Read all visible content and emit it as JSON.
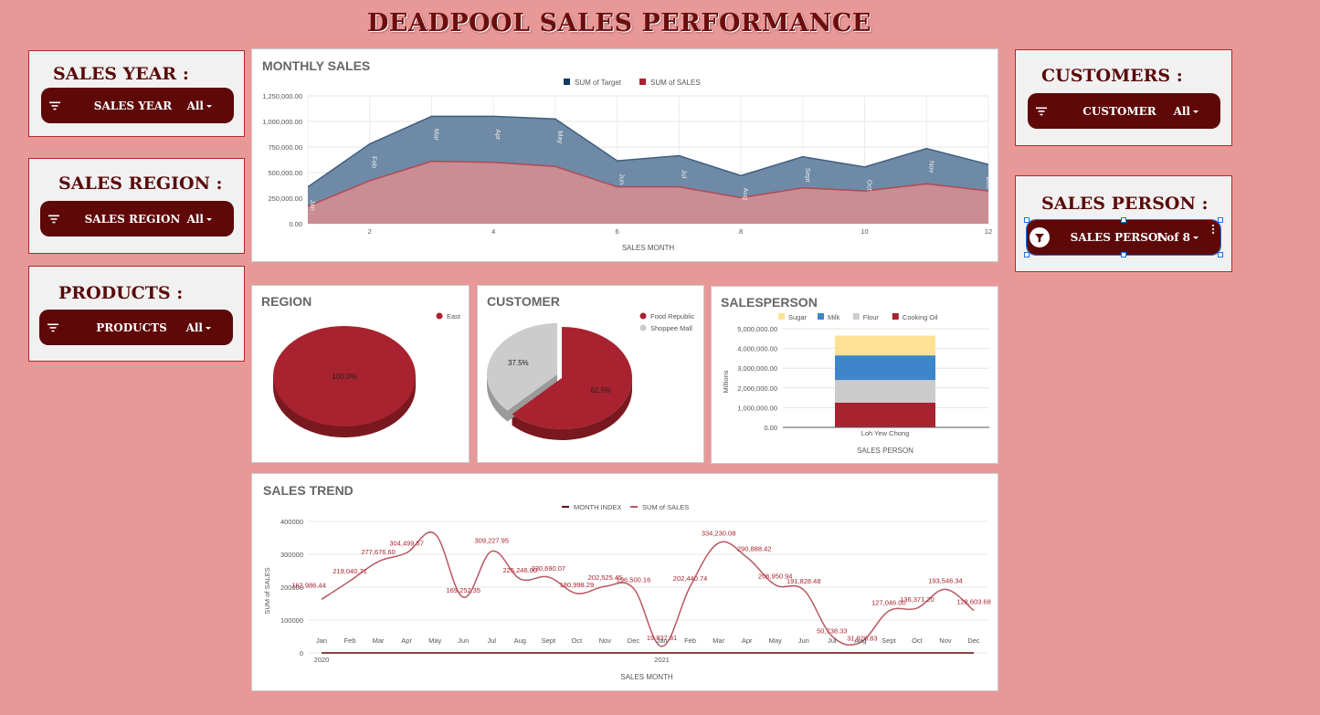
{
  "page_title": "DEADPOOL SALES PERFORMANCE",
  "colors": {
    "background": "#e99898",
    "pill": "#5e0808",
    "target": "#4a6f96",
    "sales": "#a8232f",
    "trend": "#b85860"
  },
  "controls": {
    "sales_year": {
      "label": "SALES YEAR :",
      "pill_label": "SALES YEAR",
      "value": "All"
    },
    "sales_region": {
      "label": "SALES REGION :",
      "pill_label": "SALES REGION",
      "value": "All"
    },
    "products": {
      "label": "PRODUCTS :",
      "pill_label": "PRODUCTS",
      "value": "All"
    },
    "customers": {
      "label": "CUSTOMERS :",
      "pill_label": "CUSTOMER",
      "value": "All"
    },
    "sales_person": {
      "label": "SALES PERSON :",
      "pill_label": "SALES PERSON",
      "value": "1 of 8"
    }
  },
  "chart_data": [
    {
      "id": "monthly",
      "type": "area",
      "title": "MONTHLY SALES",
      "xlabel": "SALES MONTH",
      "x": [
        1,
        2,
        3,
        4,
        5,
        6,
        7,
        8,
        9,
        10,
        11,
        12
      ],
      "xticks": [
        "2",
        "4",
        "6",
        "8",
        "10",
        "12"
      ],
      "month_labels": [
        "Jan",
        "Feb",
        "Mar",
        "Apr",
        "May",
        "Jun",
        "Jul",
        "Aug",
        "Sept",
        "Oct",
        "Nov",
        "Dec"
      ],
      "yticks": [
        "0.00",
        "250,000.00",
        "500,000.00",
        "750,000.00",
        "1,000,000.00",
        "1,250,000.00"
      ],
      "ylim": [
        0,
        1250000
      ],
      "legend_position": "top",
      "series": [
        {
          "name": "SUM of Target",
          "color": "#0f3a66",
          "values": [
            360000,
            780000,
            1050000,
            1050000,
            1025000,
            615000,
            665000,
            470000,
            655000,
            555000,
            735000,
            580000
          ]
        },
        {
          "name": "SUM of SALES",
          "color": "#a8232f",
          "values": [
            170000,
            420000,
            610000,
            600000,
            560000,
            360000,
            360000,
            255000,
            350000,
            320000,
            390000,
            320000
          ]
        }
      ]
    },
    {
      "id": "region",
      "type": "pie",
      "title": "REGION",
      "slices": [
        {
          "name": "East",
          "value": 100.0,
          "label": "100.0%",
          "color": "#a8232f"
        }
      ]
    },
    {
      "id": "customer",
      "type": "pie",
      "title": "CUSTOMER",
      "slices": [
        {
          "name": "Food Republic",
          "value": 62.5,
          "label": "62.5%",
          "color": "#a8232f"
        },
        {
          "name": "Shoppee Mall",
          "value": 37.5,
          "label": "37.5%",
          "color": "#cccccc"
        }
      ]
    },
    {
      "id": "salesperson",
      "type": "bar",
      "title": "SALESPERSON",
      "xlabel": "SALES PERSON",
      "ylabel": "Millions",
      "categories": [
        "Loh Yew Chong"
      ],
      "ylim": [
        0,
        5000000
      ],
      "yticks": [
        "0.00",
        "1,000,000.00",
        "2,000,000.00",
        "3,000,000.00",
        "4,000,000.00",
        "5,000,000.00"
      ],
      "stacked": true,
      "series": [
        {
          "name": "Sugar",
          "color": "#fde293",
          "values": [
            1000000
          ]
        },
        {
          "name": "Milk",
          "color": "#3d86cb",
          "values": [
            1250000
          ]
        },
        {
          "name": "Flour",
          "color": "#cccccc",
          "values": [
            1150000
          ]
        },
        {
          "name": "Cooking Oil",
          "color": "#a8232f",
          "values": [
            1250000
          ]
        }
      ],
      "legend_order": [
        "Sugar",
        "Milk",
        "Flour",
        "Cooking Oil"
      ]
    },
    {
      "id": "trend",
      "type": "line",
      "title": "SALES TREND",
      "xlabel": "SALES MONTH",
      "ylabel": "SUM of SALES",
      "ylim": [
        0,
        400000
      ],
      "yticks": [
        "0",
        "100000",
        "200000",
        "300000",
        "400000"
      ],
      "month_labels": [
        "Jan",
        "Feb",
        "Mar",
        "Apr",
        "May",
        "Jun",
        "Jul",
        "Aug",
        "Sept",
        "Oct",
        "Nov",
        "Dec",
        "Jan",
        "Feb",
        "Mar",
        "Apr",
        "May",
        "Jun",
        "Jul",
        "Aug",
        "Sept",
        "Oct",
        "Nov",
        "Dec"
      ],
      "year_labels": [
        {
          "index": 0,
          "label": "2020"
        },
        {
          "index": 12,
          "label": "2021"
        }
      ],
      "series": [
        {
          "name": "MONTH INDEX",
          "color": "#5e0808",
          "values": [
            1,
            2,
            3,
            4,
            5,
            6,
            7,
            8,
            9,
            10,
            11,
            12,
            13,
            14,
            15,
            16,
            17,
            18,
            19,
            20,
            21,
            22,
            23,
            24
          ]
        },
        {
          "name": "SUM of SALES",
          "color": "#b85860",
          "values": [
            162986.44,
            219040.71,
            277676.6,
            304499.57,
            362000,
            169252.35,
            309227.95,
            225246.0,
            230690.07,
            180998.29,
            202525.45,
            196500.16,
            19837.31,
            202440.74,
            334230.08,
            290888.42,
            206950.94,
            191828.48,
            50738.33,
            31926.83,
            127046.0,
            136371.2,
            193546.34,
            128603.68
          ],
          "labels": [
            "162,986.44",
            "219,040.71",
            "277,676.60",
            "304,499.57",
            "",
            "169,252.35",
            "309,227.95",
            "225,246.00",
            "230,690.07",
            "180,998.29",
            "202,525.45",
            "196,500.16",
            "19,837.31",
            "202,440.74",
            "334,230.08",
            "290,888.42",
            "206,950.94",
            "191,828.48",
            "50,738.33",
            "31,926.83",
            "127,046.00",
            "136,371.20",
            "193,546.34",
            "128,603.68"
          ]
        }
      ]
    }
  ]
}
